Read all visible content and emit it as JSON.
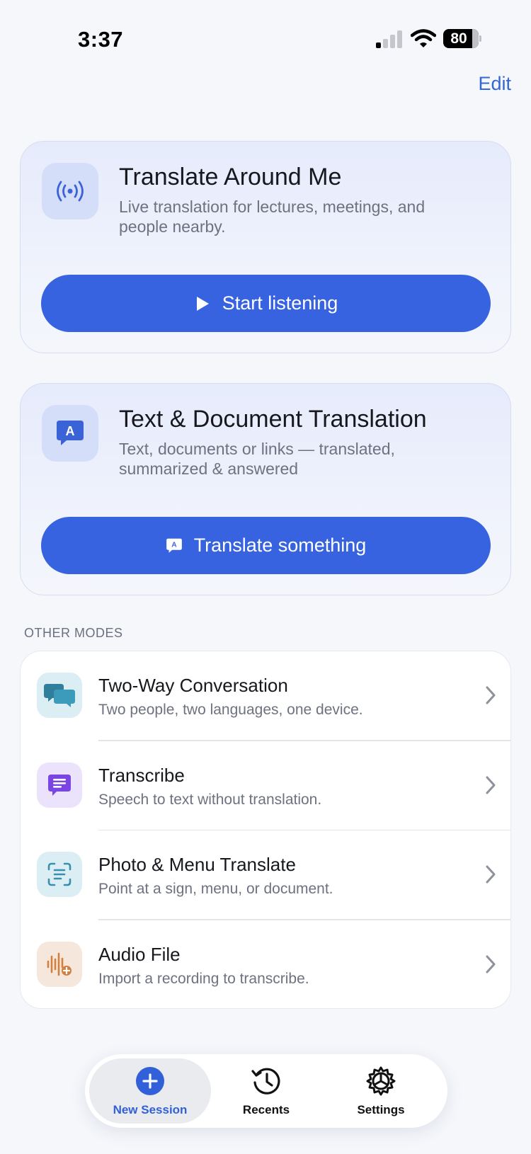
{
  "status_bar": {
    "time": "3:37",
    "battery": "80"
  },
  "header": {
    "edit_label": "Edit"
  },
  "hero_cards": [
    {
      "title": "Translate Around Me",
      "description": "Live translation for lectures, meetings, and people nearby.",
      "button_label": "Start listening",
      "icon": "broadcast-icon",
      "button_icon": "play-icon"
    },
    {
      "title": "Text & Document Translation",
      "description": "Text, documents or links — translated, summarized & answered",
      "button_label": "Translate something",
      "icon": "translate-bubble-icon",
      "button_icon": "translate-bubble-icon",
      "icon_glyph": "A"
    }
  ],
  "other_modes": {
    "label": "OTHER MODES",
    "items": [
      {
        "title": "Two-Way Conversation",
        "description": "Two people, two languages, one device.",
        "icon": "conversation-icon",
        "icon_bg": "#dbeef3",
        "icon_color": "#2f8aa6"
      },
      {
        "title": "Transcribe",
        "description": "Speech to text without translation.",
        "icon": "transcript-icon",
        "icon_bg": "#ebe3fb",
        "icon_color": "#7b45e4"
      },
      {
        "title": "Photo & Menu Translate",
        "description": "Point at a sign, menu, or document.",
        "icon": "scan-text-icon",
        "icon_bg": "#dbeef3",
        "icon_color": "#3a8fb0"
      },
      {
        "title": "Audio File",
        "description": "Import a recording to transcribe.",
        "icon": "audio-file-icon",
        "icon_bg": "#f6e7dc",
        "icon_color": "#d37f3e"
      }
    ]
  },
  "tab_bar": {
    "tabs": [
      {
        "label": "New Session",
        "icon": "plus-circle-icon",
        "active": true
      },
      {
        "label": "Recents",
        "icon": "history-icon",
        "active": false
      },
      {
        "label": "Settings",
        "icon": "gear-icon",
        "active": false
      }
    ]
  },
  "colors": {
    "accent": "#3863e0",
    "link": "#3366d6",
    "active_tab": "#3160d8"
  }
}
